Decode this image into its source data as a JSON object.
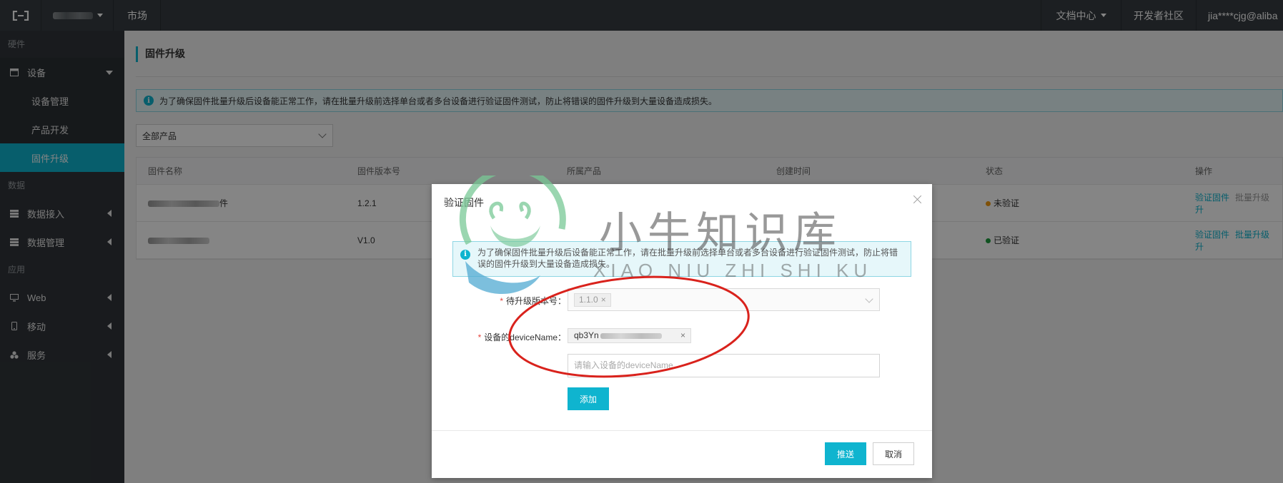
{
  "topbar": {
    "logo_icon": "aliyun-logo-icon",
    "market": "市场",
    "doc_center": "文档中心",
    "community": "开发者社区",
    "user": "jia****cjg@aliba"
  },
  "sidebar": {
    "groups": {
      "hardware": "硬件",
      "data": "数据",
      "apps": "应用"
    },
    "device": "设备",
    "device_sub": [
      "设备管理",
      "产品开发",
      "固件升级"
    ],
    "data_access": "数据接入",
    "data_manage": "数据管理",
    "web": "Web",
    "mobile": "移动",
    "service": "服务"
  },
  "main": {
    "title": "固件升级",
    "notice": "为了确保固件批量升级后设备能正常工作，请在批量升级前选择单台或者多台设备进行验证固件测试，防止将错误的固件升级到大量设备造成损失。",
    "product_select": "全部产品",
    "table": {
      "headers": [
        "固件名称",
        "固件版本号",
        "所属产品",
        "创建时间",
        "状态",
        "操作"
      ],
      "rows": [
        {
          "name_suffix": "件",
          "version": "1.2.1",
          "status": "未验证",
          "status_color": "#f39c12",
          "actions": [
            "验证固件",
            "批量升级",
            "升"
          ]
        },
        {
          "name_suffix": "",
          "version": "V1.0",
          "status": "已验证",
          "status_color": "#1e9e3e",
          "actions": [
            "验证固件",
            "批量升级",
            "升"
          ]
        }
      ]
    }
  },
  "modal": {
    "title": "验证固件",
    "notice": "为了确保固件批量升级后设备能正常工作，请在批量升级前选择单台或者多台设备进行验证固件测试，防止将错误的固件升级到大量设备造成损失。",
    "version_label": "待升级版本号：",
    "version_value": "1.1.0",
    "device_label": "设备的deviceName：",
    "device_tag_prefix": "qb3Yn",
    "device_placeholder": "请输入设备的deviceName",
    "add_button": "添加",
    "push_button": "推送",
    "cancel_button": "取消"
  },
  "watermark": {
    "text": "小牛知识库",
    "sub": "XIAO NIU ZHI SHI KU"
  },
  "colors": {
    "accent": "#0fb4cf",
    "topbar": "#373d41",
    "sidebar": "#30353a",
    "annotation": "#d9221c"
  }
}
